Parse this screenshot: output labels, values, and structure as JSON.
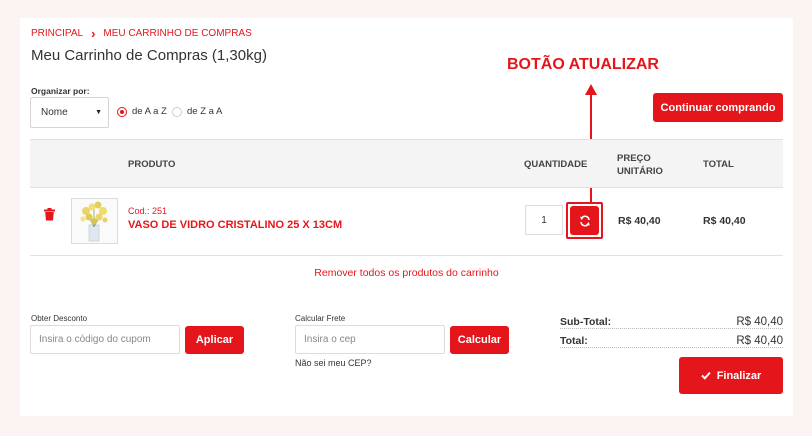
{
  "breadcrumb": {
    "home": "PRINCIPAL",
    "separator": "›",
    "current": "MEU CARRINHO DE COMPRAS"
  },
  "page_title": "Meu Carrinho de Compras (1,30kg)",
  "annotation": {
    "label": "BOTÃO ATUALIZAR"
  },
  "sort": {
    "label": "Organizar por:",
    "selected": "Nome",
    "options": [
      {
        "label": "de A a Z",
        "checked": true
      },
      {
        "label": "de Z a A",
        "checked": false
      }
    ]
  },
  "continue_button": "Continuar comprando",
  "table": {
    "headers": {
      "product": "PRODUTO",
      "quantity": "QUANTIDADE",
      "unit_price_line1": "PREÇO",
      "unit_price_line2": "UNITÁRIO",
      "total": "TOTAL"
    },
    "rows": [
      {
        "code": "Cod.: 251",
        "name": "VASO DE VIDRO CRISTALINO 25 X 13CM",
        "quantity": "1",
        "unit_price": "R$ 40,40",
        "total": "R$ 40,40"
      }
    ]
  },
  "remove_all": "Remover todos os produtos do carrinho",
  "discount": {
    "label": "Obter Desconto",
    "placeholder": "Insira o código do cupom",
    "button": "Aplicar"
  },
  "shipping": {
    "label": "Calcular Frete",
    "placeholder": "Insira o cep",
    "button": "Calcular",
    "help_link": "Não sei meu CEP?"
  },
  "summary": {
    "subtotal_label": "Sub-Total:",
    "subtotal_value": "R$ 40,40",
    "total_label": "Total:",
    "total_value": "R$ 40,40"
  },
  "finalize_button": "Finalizar",
  "colors": {
    "accent": "#e5161b",
    "header_bg": "#f4f4f4",
    "page_bg": "#fbf4f2"
  },
  "icons": {
    "delete": "trash-icon",
    "refresh": "refresh-icon",
    "check": "check-icon",
    "chevron": "chevron-down-icon"
  }
}
